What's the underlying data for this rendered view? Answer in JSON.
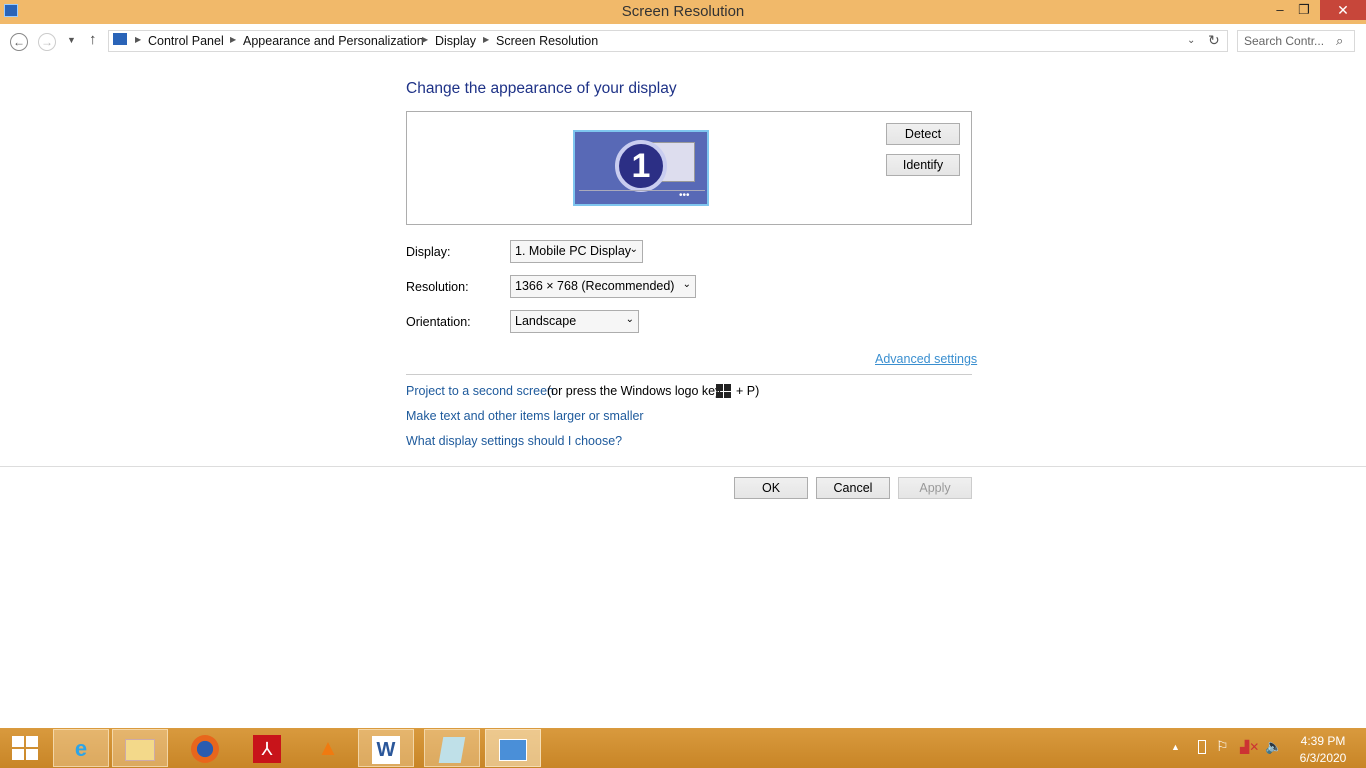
{
  "window": {
    "title": "Screen Resolution",
    "minimize": "–",
    "restore": "❐",
    "close": "✕"
  },
  "address": {
    "crumbs": [
      "Control Panel",
      "Appearance and Personalization",
      "Display",
      "Screen Resolution"
    ],
    "search_placeholder": "Search Contr..."
  },
  "main": {
    "heading": "Change the appearance of your display",
    "monitor_number": "1",
    "detect": "Detect",
    "identify": "Identify",
    "display_label": "Display:",
    "display_value": "1. Mobile PC Display",
    "resolution_label": "Resolution:",
    "resolution_value": "1366 × 768 (Recommended)",
    "orientation_label": "Orientation:",
    "orientation_value": "Landscape",
    "advanced": "Advanced settings",
    "project_link": "Project to a second screen",
    "project_hint": "(or press the Windows logo key",
    "project_hint_end": "+ P)",
    "text_size_link": "Make text and other items larger or smaller",
    "help_link": "What display settings should I choose?",
    "ok": "OK",
    "cancel": "Cancel",
    "apply": "Apply"
  },
  "taskbar": {
    "apps": [
      "start",
      "internet-explorer",
      "file-explorer",
      "firefox",
      "adobe-reader",
      "vlc",
      "word",
      "notepad",
      "control-panel"
    ],
    "time": "4:39 PM",
    "date": "6/3/2020"
  }
}
